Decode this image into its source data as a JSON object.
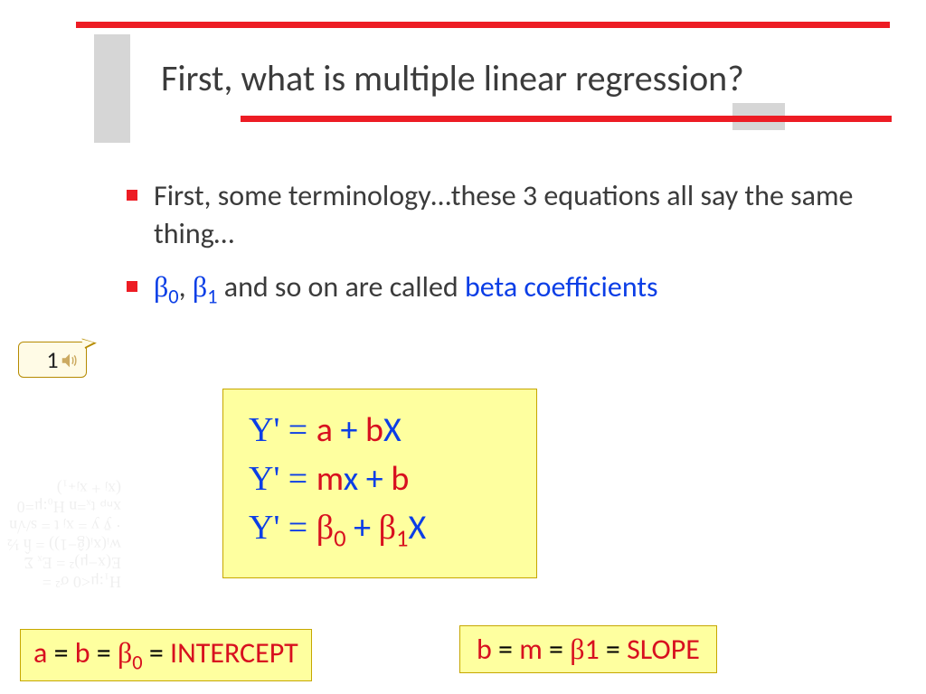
{
  "title": "First, what is multiple linear regression?",
  "bullets": [
    {
      "text_plain": "First, some terminology…these 3 equations all say the same thing…"
    },
    {
      "beta0": "β",
      "sub0": "0",
      "sep": ", ",
      "beta1": "β",
      "sub1": "1",
      "rest": " and so on are called ",
      "term": "beta coefficients"
    }
  ],
  "callout": {
    "label": "1"
  },
  "equations": {
    "line1": {
      "y": "Y' = ",
      "a": "a",
      "plus": " + ",
      "b": "b",
      "x": "X"
    },
    "line2": {
      "y": "Y' = ",
      "m": "m",
      "x": "x",
      "plus": " + ",
      "b": "b"
    },
    "line3": {
      "y": "Y' = ",
      "b0": "β",
      "s0": "0",
      "plus": " + ",
      "b1": "β",
      "s1": "1",
      "x": "X"
    }
  },
  "intercept_box": {
    "a": "a",
    "eq1": " = ",
    "b": "b",
    "eq2": " = ",
    "beta": "β",
    "s0": "0",
    "eq3": " = ",
    "label": "INTERCEPT"
  },
  "slope_box": {
    "b": "b",
    "eq1": " = ",
    "m": "m",
    "eq2": " = ",
    "beta": "β",
    "s1": "1",
    "eq3": " = ",
    "label": "SLOPE"
  },
  "bg_math": "H₁:μ<0\nσ² = E(x−μ)² = Eₓ Σ wᵢ(xᵢ(ĝ−1)) = ĥ\n½ · ȳ   y = xⱼ\nt = s/√n  xₙₚ  tₓ=n\nH₀:μ=0  (xⱼ + xⱼ₊₁)"
}
